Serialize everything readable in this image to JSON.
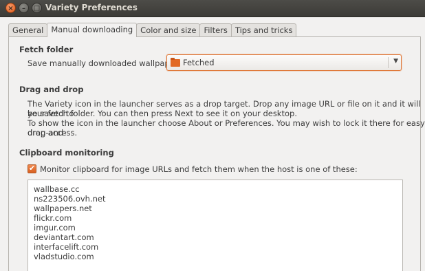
{
  "window": {
    "title": "Variety Preferences",
    "close_glyph": "×",
    "min_glyph": "–",
    "max_glyph": "□"
  },
  "tabs": [
    {
      "label": "General"
    },
    {
      "label": "Manual downloading"
    },
    {
      "label": "Color and size"
    },
    {
      "label": "Filters"
    },
    {
      "label": "Tips and tricks"
    }
  ],
  "fetch_folder": {
    "heading": "Fetch folder",
    "label": "Save manually downloaded wallpapers to",
    "selected": "Fetched",
    "icon": "folder-icon"
  },
  "drag_drop": {
    "heading": "Drag and drop",
    "lines": [
      "The Variety icon in the launcher serves as a drop target. Drop any image URL or file on it and it will be saved to",
      "your fetch folder. You can then press Next to see it on your desktop.",
      "To show the icon in the launcher choose About or Preferences. You may wish to lock it there for easy drag-and-",
      "drop access."
    ]
  },
  "clipboard": {
    "heading": "Clipboard monitoring",
    "checkbox_label": "Monitor clipboard for image URLs and fetch them when the host is one of these:",
    "checked": true,
    "hosts": [
      "wallbase.cc",
      "ns223506.ovh.net",
      "wallpapers.net",
      "flickr.com",
      "imgur.com",
      "deviantart.com",
      "interfacelift.com",
      "vladstudio.com"
    ]
  },
  "colors": {
    "accent": "#e07a3c",
    "titlebar": "#3c3b37"
  }
}
